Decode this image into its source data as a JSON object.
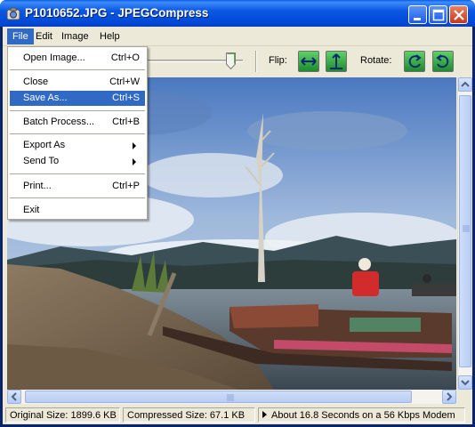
{
  "window": {
    "title": "P1010652.JPG - JPEGCompress"
  },
  "menubar": {
    "items": [
      {
        "label": "File"
      },
      {
        "label": "Edit"
      },
      {
        "label": "Image"
      },
      {
        "label": "Help"
      }
    ]
  },
  "file_menu": {
    "items": [
      {
        "label": "Open Image...",
        "shortcut": "Ctrl+O"
      },
      {
        "label": "Close",
        "shortcut": "Ctrl+W"
      },
      {
        "label": "Save As...",
        "shortcut": "Ctrl+S",
        "highlighted": true
      },
      {
        "label": "Batch Process...",
        "shortcut": "Ctrl+B"
      },
      {
        "label": "Export As",
        "submenu": true
      },
      {
        "label": "Send To",
        "submenu": true
      },
      {
        "label": "Print...",
        "shortcut": "Ctrl+P"
      },
      {
        "label": "Exit"
      }
    ]
  },
  "toolbar": {
    "flip_label": "Flip:",
    "rotate_label": "Rotate:",
    "buttons": [
      "flip-horizontal-icon",
      "flip-vertical-icon",
      "rotate-left-icon",
      "rotate-right-icon"
    ]
  },
  "statusbar": {
    "original_size": "Original Size: 1899.6 KB",
    "compressed_size": "Compressed Size: 67.1 KB",
    "download_time": "About 16.8 Seconds on a 56 Kbps Modem"
  },
  "colors": {
    "titlebar": "#0b58e2",
    "menu_highlight": "#316ac5",
    "window_bg": "#ece9d8"
  }
}
